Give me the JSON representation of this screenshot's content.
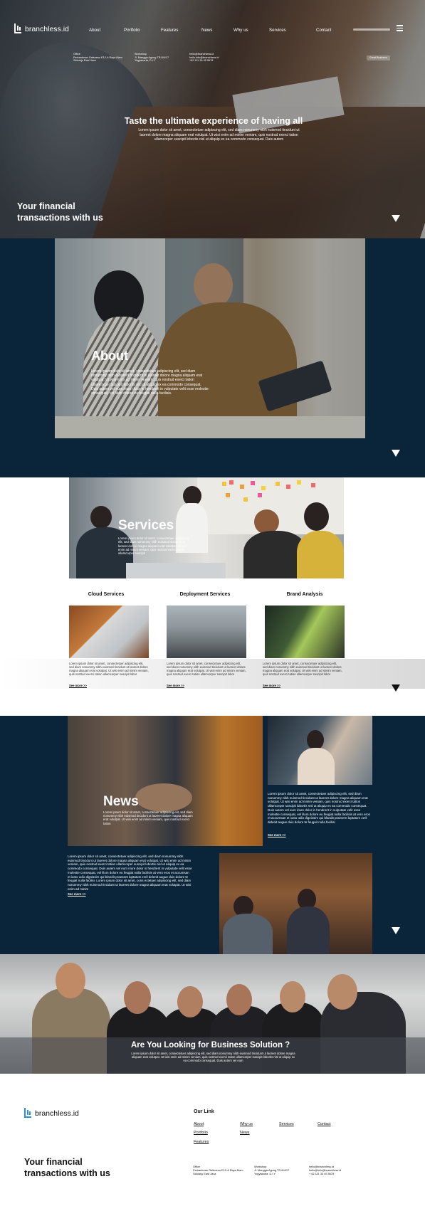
{
  "brand": {
    "name": "branchless.id"
  },
  "nav": {
    "about": "About",
    "portfolio": "Portfolio",
    "features": "Features",
    "news": "News",
    "why_us": "Why us",
    "services": "Services",
    "contact": "Contact"
  },
  "hero": {
    "office_label": "Office",
    "office_addr1": "Perkantoran Gatsoesu E12-A Raya Maro",
    "office_addr2": "Sidoarjo East Java",
    "workshop_label": "Workshop",
    "workshop_addr1": "Jl. Mangga Agung TR.8/4/17",
    "workshop_addr2": "Yogyakarta, D.I.Y",
    "email": "hello@branchless.id",
    "email2": "hello.info@branchless.id",
    "phone": "+62 111 33 45 5678",
    "badge": "Great Business",
    "title": "Taste the ultimate experience of having all",
    "body": "Lorem ipsum dolor sit amet, consectetuer adipiscing elit, sed diam nonummy nibh euismod tincidunt ut laoreet dolore magna aliquam erat volutpat. Ut wisi enim ad minim veniam, quis nostrud exerci tation ullamcorper suscipit lobortis nisl ut aliquip ex ea commodo consequat. Duis autem",
    "tagline_line1": "Your financial",
    "tagline_line2": "transactions with us"
  },
  "about": {
    "title": "About",
    "body": "Lorem ipsum dolor sit amet, consectetuer adipiscing elit, sed diam nonummy nibh euismod tincidunt ut laoreet dolore magna aliquam erat volutpat. Ut wisi enim ad minim veniam, quis nostrud exerci tation ullamcorper suscipit lobortis nisl ut aliquip ex ea commodo consequat. Duis autem vel eum iriure dolor in hendrerit in vulputate velit esse molestie consequat, vel illum dolore eu feugiat nulla facilisis."
  },
  "services": {
    "title": "Services",
    "body": "Lorem ipsum dolor sit amet, consectetuer adipiscing elit, sed diam nonummy nibh euismod tincidunt ut laoreet dolore magna aliquam erat volutpat. Ut wisi enim ad minim veniam, quis nostrud exerci tation ullamcorper suscipit",
    "cards": [
      {
        "title": "Cloud Services",
        "text": "Lorem ipsum dolor sit amet, consectetuer adipiscing elit, sed diam nonummy nibh euismod tincidunt ut laoreet dolore magna aliquam erat volutpat. Ut wisi enim ad minim veniam, quis nostrud exerci tation ullamcorper suscipit lobor",
        "more": "See more >>"
      },
      {
        "title": "Deployment Services",
        "text": "Lorem ipsum dolor sit amet, consectetuer adipiscing elit, sed diam nonummy nibh euismod tincidunt ut laoreet dolore magna aliquam erat volutpat. Ut wisi enim ad minim veniam, quis nostrud exerci tation ullamcorper suscipit lobor",
        "more": "See more >>"
      },
      {
        "title": "Brand Analysis",
        "text": "Lorem ipsum dolor sit amet, consectetuer adipiscing elit, sed diam nonummy nibh euismod tincidunt ut laoreet dolore magna aliquam erat volutpat. Ut wisi enim ad minim veniam, quis nostrud exerci tation ullamcorper suscipit lobor",
        "more": "See more >>"
      }
    ]
  },
  "news": {
    "title": "News",
    "body": "Lorem ipsum dolor sit amet, consectetuer adipiscing elit, sed diam nonummy nibh euismod tincidunt ut laoreet dolore magna aliquam erat volutpat. Ut wisi enim ad minim veniam, quis nostrud exerci tation",
    "item1_text": "Lorem ipsum dolor sit amet, consectetuer adipiscing elit, sed diam nonummy nibh euismod tincidunt ut laoreet dolore magna aliquam erat volutpat. Ut wisi enim ad minim veniam, quis nostrud exerci tation ullamcorper suscipit lobortis nisl ut aliquip ex ea commodo consequat. Duis autem vel eum iriure dolor in hendrerit in vulputate velit esse molestie consequat, vel illum dolore eu feugiat nulla facilisis at vero eros et accumsan et iusto odio dignissim qui blandit praesent luptatum zzril delenit augue duis dolore te feugait nulla facilisi.",
    "item1_more": "See more >>",
    "item2_text": "Lorem ipsum dolor sit amet, consectetuer adipiscing elit, sed diam nonummy nibh euismod tincidunt ut laoreet dolore magna aliquam erat volutpat. Ut wisi enim ad minim veniam, quis nostrud exerci tation ullamcorper suscipit lobortis nisl ut aliquip ex ea commodo consequat. Duis autem vel eum iriure dolor in hendrerit in vulputate velit esse molestie consequat, vel illum dolore eu feugiat nulla facilisis at vero eros et accumsan et iusto odio dignissim qui blandit praesent luptatum zzril delenit augue duis dolore te feugait nulla facilisi. Lorem ipsum dolor sit amet, cons ectetuer adipiscing elit, sed diam nonummy nibh euismod tincidunt ut laoreet dolore magna aliquam erat volutpat. Ut wisi enim ad minim",
    "item2_more": "See more >>"
  },
  "team": {
    "title": "Are You Looking for Business Solution ?",
    "body": "Lorem ipsum dolor sit amet, consectetuer adipiscing elit, sed diam nonummy nibh euismod tincidunt ut laoreet dolore magna aliquam erat volutpat. Ut wisi enim ad minim veniam, quis nostrud exerci tation ullamcorper suscipit lobortis nisl ut aliquip ex ea commodo consequat. Duis autem vel eum"
  },
  "footer": {
    "our_link": "Our Link",
    "links": {
      "about": "About",
      "why_us": "Why us",
      "services": "Services",
      "contact": "Contact",
      "portfolio": "Portfolio",
      "news": "News",
      "features": "Features"
    },
    "tagline_line1": "Your financial",
    "tagline_line2": "transactions with us",
    "office_label": "Office",
    "office_addr1": "Perkantoran Gatsoesu E12-A Raya Maro",
    "office_addr2": "Sidoarjo East Java",
    "workshop_label": "Workshop",
    "workshop_addr1": "Jl. Mangga Agung TR.8/4/17",
    "workshop_addr2": "Yogyakarta, D.I.Y",
    "email": "hello@branchless.id",
    "email2": "hello@info@branchless.id",
    "phone": "+ 62 111 33 45 5678"
  },
  "colors": {
    "navy": "#0a2539",
    "logo_blue": "#2f8fd0"
  },
  "icons": [
    "logo-mark-icon",
    "hamburger-menu-icon",
    "scroll-down-icon"
  ]
}
